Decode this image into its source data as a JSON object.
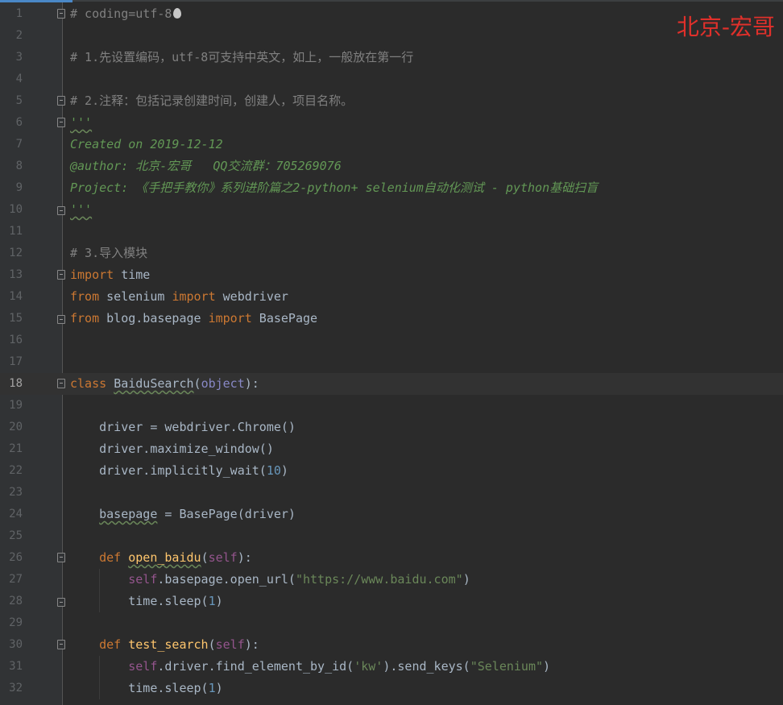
{
  "watermark": "北京-宏哥",
  "colors": {
    "keyword": "#cc7832",
    "comment": "#808080",
    "docstring": "#629755",
    "string": "#6a8759",
    "number": "#6897bb",
    "self": "#94558d",
    "function": "#ffc66d",
    "watermark": "#e0302b"
  },
  "current_line": 18,
  "lines": [
    {
      "n": "1",
      "fold": "start",
      "indent": 0,
      "tokens": [
        {
          "t": "# coding=utf-8",
          "c": "cmt"
        }
      ],
      "icon": "flame-icon"
    },
    {
      "n": "2",
      "tokens": []
    },
    {
      "n": "3",
      "tokens": [
        {
          "t": "# 1.先设置编码，utf-8可支持中英文，如上，一般放在第一行",
          "c": "cmt"
        }
      ]
    },
    {
      "n": "4",
      "tokens": []
    },
    {
      "n": "5",
      "fold": "start",
      "tokens": [
        {
          "t": "# 2.注释：包括记录创建时间，创建人，项目名称。",
          "c": "cmt"
        }
      ]
    },
    {
      "n": "6",
      "fold": "start",
      "tokens": [
        {
          "t": "'''",
          "c": "doc squig"
        }
      ]
    },
    {
      "n": "7",
      "tokens": [
        {
          "t": "Created on 2019-12-12",
          "c": "doc"
        }
      ]
    },
    {
      "n": "8",
      "tokens": [
        {
          "t": "@author: 北京-宏哥   QQ交流群：705269076",
          "c": "doc"
        }
      ]
    },
    {
      "n": "9",
      "tokens": [
        {
          "t": "Project: 《手把手教你》系列进阶篇之2-python+ selenium自动化测试 - python基础扫盲",
          "c": "doc"
        }
      ]
    },
    {
      "n": "10",
      "fold": "end",
      "tokens": [
        {
          "t": "'''",
          "c": "doc squig"
        }
      ]
    },
    {
      "n": "11",
      "tokens": []
    },
    {
      "n": "12",
      "tokens": [
        {
          "t": "# 3.导入模块",
          "c": "cmt"
        }
      ]
    },
    {
      "n": "13",
      "fold": "start",
      "tokens": [
        {
          "t": "import",
          "c": "kw"
        },
        {
          "t": " time"
        }
      ]
    },
    {
      "n": "14",
      "tokens": [
        {
          "t": "from",
          "c": "kw"
        },
        {
          "t": " selenium "
        },
        {
          "t": "import",
          "c": "kw"
        },
        {
          "t": " webdriver"
        }
      ]
    },
    {
      "n": "15",
      "fold": "end",
      "tokens": [
        {
          "t": "from",
          "c": "kw"
        },
        {
          "t": " blog.basepage "
        },
        {
          "t": "import",
          "c": "kw"
        },
        {
          "t": " BasePage"
        }
      ]
    },
    {
      "n": "16",
      "tokens": []
    },
    {
      "n": "17",
      "tokens": []
    },
    {
      "n": "18",
      "fold": "start",
      "tokens": [
        {
          "t": "class",
          "c": "kw"
        },
        {
          "t": " "
        },
        {
          "t": "BaiduSearch",
          "c": "squig"
        },
        {
          "t": "("
        },
        {
          "t": "object",
          "c": "builtin"
        },
        {
          "t": "):"
        }
      ]
    },
    {
      "n": "19",
      "tokens": []
    },
    {
      "n": "20",
      "tokens": [
        {
          "t": "    driver = webdriver.Chrome()"
        }
      ]
    },
    {
      "n": "21",
      "tokens": [
        {
          "t": "    driver.maximize_window()"
        }
      ]
    },
    {
      "n": "22",
      "tokens": [
        {
          "t": "    driver.implicitly_wait("
        },
        {
          "t": "10",
          "c": "num"
        },
        {
          "t": ")"
        }
      ]
    },
    {
      "n": "23",
      "tokens": []
    },
    {
      "n": "24",
      "tokens": [
        {
          "t": "    "
        },
        {
          "t": "basepage",
          "c": "squig"
        },
        {
          "t": " = BasePage(driver)"
        }
      ]
    },
    {
      "n": "25",
      "tokens": []
    },
    {
      "n": "26",
      "fold": "start",
      "tokens": [
        {
          "t": "    "
        },
        {
          "t": "def",
          "c": "kw"
        },
        {
          "t": " "
        },
        {
          "t": "open_baidu",
          "c": "fn squig"
        },
        {
          "t": "("
        },
        {
          "t": "self",
          "c": "selfkw"
        },
        {
          "t": "):"
        }
      ]
    },
    {
      "n": "27",
      "tokens": [
        {
          "t": "        "
        },
        {
          "t": "self",
          "c": "selfkw"
        },
        {
          "t": ".basepage.open_url("
        },
        {
          "t": "\"https://www.baidu.com\"",
          "c": "str"
        },
        {
          "t": ")"
        }
      ]
    },
    {
      "n": "28",
      "fold": "end",
      "tokens": [
        {
          "t": "        time.sleep("
        },
        {
          "t": "1",
          "c": "num"
        },
        {
          "t": ")"
        }
      ]
    },
    {
      "n": "29",
      "tokens": []
    },
    {
      "n": "30",
      "fold": "start",
      "tokens": [
        {
          "t": "    "
        },
        {
          "t": "def",
          "c": "kw"
        },
        {
          "t": " "
        },
        {
          "t": "test_search",
          "c": "fn"
        },
        {
          "t": "("
        },
        {
          "t": "self",
          "c": "selfkw"
        },
        {
          "t": "):"
        }
      ]
    },
    {
      "n": "31",
      "tokens": [
        {
          "t": "        "
        },
        {
          "t": "self",
          "c": "selfkw"
        },
        {
          "t": ".driver.find_element_by_id("
        },
        {
          "t": "'kw'",
          "c": "str"
        },
        {
          "t": ").send_keys("
        },
        {
          "t": "\"Selenium\"",
          "c": "str"
        },
        {
          "t": ")"
        }
      ]
    },
    {
      "n": "32",
      "tokens": [
        {
          "t": "        time.sleep("
        },
        {
          "t": "1",
          "c": "num"
        },
        {
          "t": ")"
        }
      ]
    }
  ]
}
